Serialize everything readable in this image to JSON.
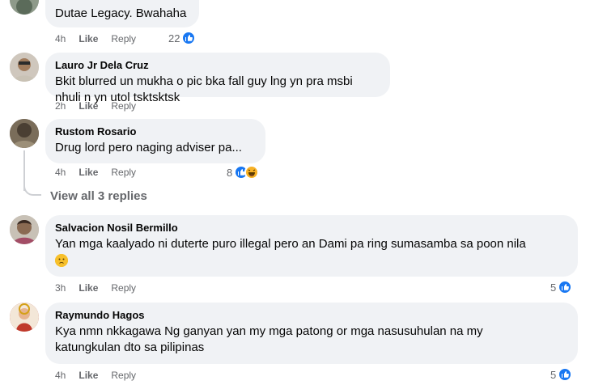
{
  "actions": {
    "like": "Like",
    "reply": "Reply"
  },
  "comments": [
    {
      "name": "",
      "text": "Dutae Legacy. Bwahaha",
      "time": "4h",
      "reaction_count": "22",
      "reaction_icons": [
        "like-icon"
      ]
    },
    {
      "name": "Lauro Jr Dela Cruz",
      "text": "Bkit blurred un mukha o pic bka fall guy lng yn pra msbi nhuli n yn utol tsktsktsk",
      "time": "2h",
      "reaction_count": "",
      "reaction_icons": []
    },
    {
      "name": "Rustom Rosario",
      "text": "Drug lord pero naging adviser pa...",
      "time": "4h",
      "reaction_count": "8",
      "reaction_icons": [
        "like-icon",
        "haha-icon"
      ]
    },
    {
      "name": "Salvacion Nosil Bermillo",
      "text": "Yan mga kaalyado ni duterte puro illegal pero an Dami pa ring sumasamba sa poon nila",
      "emoji": "sad-face-emoji",
      "time": "3h",
      "reaction_count": "5",
      "reaction_icons": [
        "like-icon"
      ]
    },
    {
      "name": "Raymundo Hagos",
      "text_line1": "Kya nmn nkkagawa Ng ganyan yan my mga patong or mga nasusuhulan na my",
      "text_line2": "katungkulan dto sa pilipinas",
      "time": "4h",
      "reaction_count": "5",
      "reaction_icons": [
        "like-icon"
      ]
    }
  ],
  "view_replies": "View all 3 replies",
  "colors": {
    "bubble": "#f0f2f5",
    "like": "#1877f2",
    "meta": "#65676b",
    "haha": "#f7b125"
  }
}
